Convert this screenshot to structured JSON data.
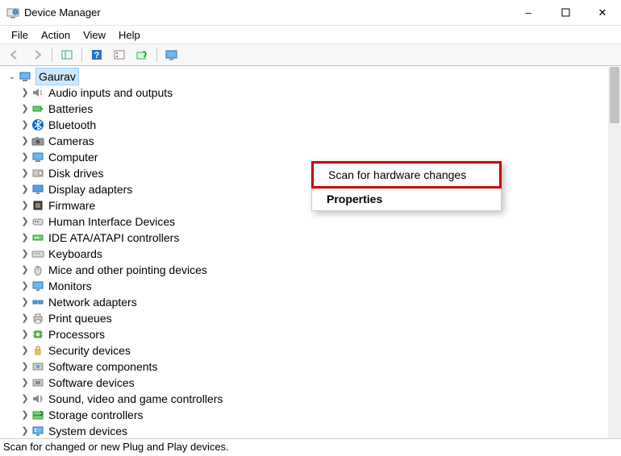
{
  "window": {
    "title": "Device Manager"
  },
  "menu": {
    "file": "File",
    "action": "Action",
    "view": "View",
    "help": "Help"
  },
  "tree": {
    "root": "Gaurav",
    "items": [
      {
        "label": "Audio inputs and outputs",
        "icon": "audio"
      },
      {
        "label": "Batteries",
        "icon": "battery"
      },
      {
        "label": "Bluetooth",
        "icon": "bluetooth"
      },
      {
        "label": "Cameras",
        "icon": "camera"
      },
      {
        "label": "Computer",
        "icon": "computer"
      },
      {
        "label": "Disk drives",
        "icon": "disk"
      },
      {
        "label": "Display adapters",
        "icon": "display"
      },
      {
        "label": "Firmware",
        "icon": "firmware"
      },
      {
        "label": "Human Interface Devices",
        "icon": "hid"
      },
      {
        "label": "IDE ATA/ATAPI controllers",
        "icon": "ide"
      },
      {
        "label": "Keyboards",
        "icon": "keyboard"
      },
      {
        "label": "Mice and other pointing devices",
        "icon": "mouse"
      },
      {
        "label": "Monitors",
        "icon": "monitor"
      },
      {
        "label": "Network adapters",
        "icon": "network"
      },
      {
        "label": "Print queues",
        "icon": "printer"
      },
      {
        "label": "Processors",
        "icon": "cpu"
      },
      {
        "label": "Security devices",
        "icon": "security"
      },
      {
        "label": "Software components",
        "icon": "swcomp"
      },
      {
        "label": "Software devices",
        "icon": "swdev"
      },
      {
        "label": "Sound, video and game controllers",
        "icon": "sound"
      },
      {
        "label": "Storage controllers",
        "icon": "storage"
      },
      {
        "label": "System devices",
        "icon": "system"
      }
    ]
  },
  "context": {
    "scan": "Scan for hardware changes",
    "props": "Properties"
  },
  "status": "Scan for changed or new Plug and Play devices."
}
